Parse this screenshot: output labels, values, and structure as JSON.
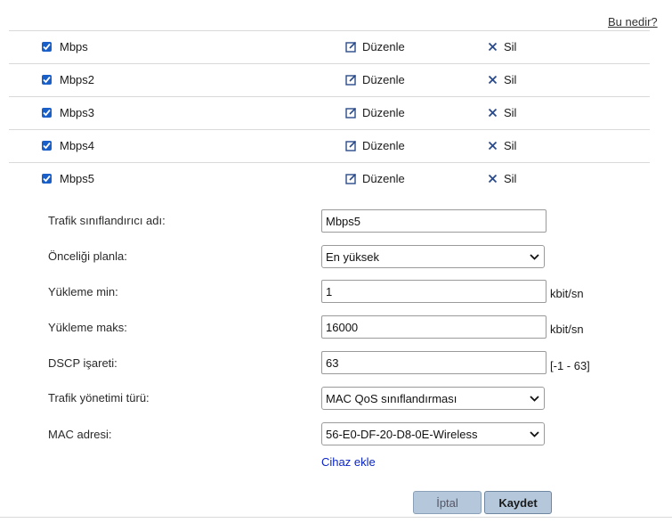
{
  "help_link": "Bu nedir?",
  "rules": [
    {
      "name": "Mbps",
      "edit_label": "Düzenle",
      "delete_label": "Sil",
      "checked": true
    },
    {
      "name": "Mbps2",
      "edit_label": "Düzenle",
      "delete_label": "Sil",
      "checked": true
    },
    {
      "name": "Mbps3",
      "edit_label": "Düzenle",
      "delete_label": "Sil",
      "checked": true
    },
    {
      "name": "Mbps4",
      "edit_label": "Düzenle",
      "delete_label": "Sil",
      "checked": true
    },
    {
      "name": "Mbps5",
      "edit_label": "Düzenle",
      "delete_label": "Sil",
      "checked": true
    }
  ],
  "form": {
    "classifier_name_label": "Trafik sınıflandırıcı adı:",
    "classifier_name_value": "Mbps5",
    "priority_label": "Önceliği planla:",
    "priority_value": "En yüksek",
    "upload_min_label": "Yükleme min:",
    "upload_min_value": "1",
    "upload_min_unit": "kbit/sn",
    "upload_max_label": "Yükleme maks:",
    "upload_max_value": "16000",
    "upload_max_unit": "kbit/sn",
    "dscp_label": "DSCP işareti:",
    "dscp_value": "63",
    "dscp_range": "[-1 - 63]",
    "traffic_type_label": "Trafik yönetimi türü:",
    "traffic_type_value": "MAC QoS sınıflandırması",
    "mac_label": "MAC adresi:",
    "mac_value": "56-E0-DF-20-D8-0E-Wireless",
    "add_device_link": "Cihaz ekle"
  },
  "buttons": {
    "cancel": "İptal",
    "save": "Kaydet"
  },
  "colors": {
    "checkbox": "#1a5fc8",
    "link": "#0a24c8",
    "button_bg": "#b4c7db"
  }
}
